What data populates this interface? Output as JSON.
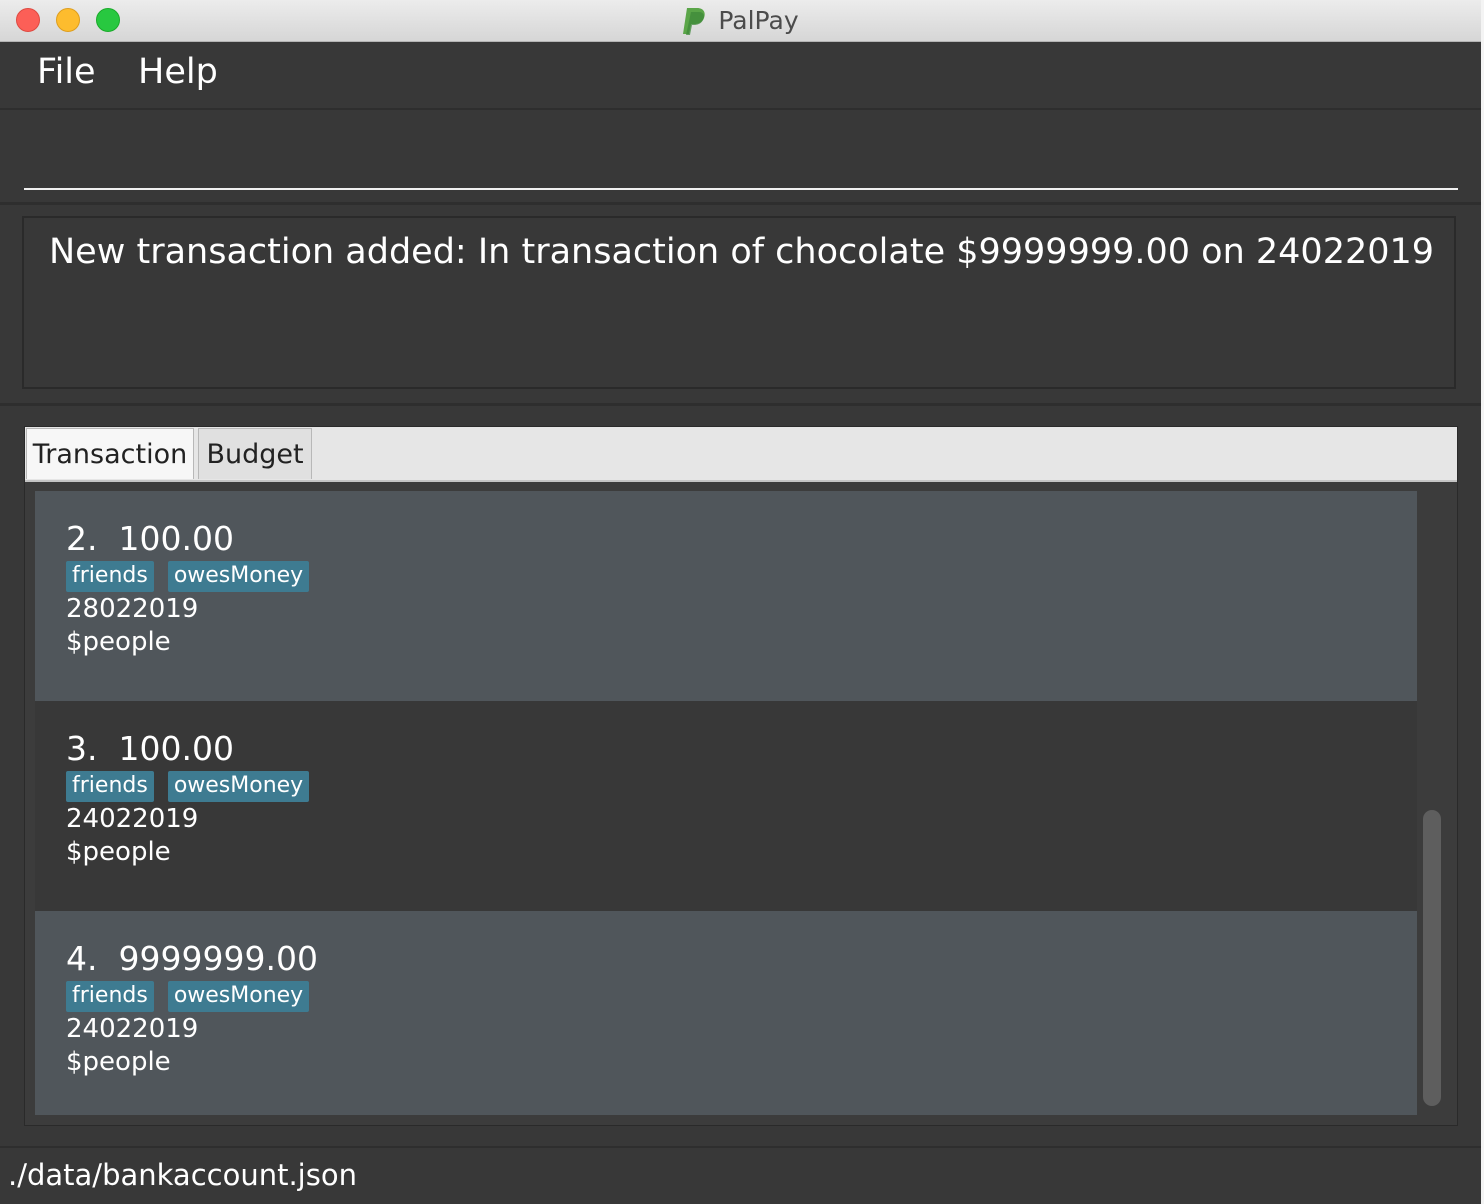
{
  "window": {
    "title": "PalPay",
    "logo_icon": "paypal-p-icon"
  },
  "menu": {
    "items": [
      {
        "label": "File"
      },
      {
        "label": "Help"
      }
    ]
  },
  "command": {
    "value": ""
  },
  "result": {
    "message": "New transaction added: In transaction of chocolate $9999999.00 on 24022019"
  },
  "tabs": [
    {
      "label": "Transaction",
      "active": true
    },
    {
      "label": "Budget",
      "active": false
    }
  ],
  "transactions": [
    {
      "index": "2.",
      "amount": "100.00",
      "tags": [
        "friends",
        "owesMoney"
      ],
      "date": "28022019",
      "description": "$people"
    },
    {
      "index": "3.",
      "amount": "100.00",
      "tags": [
        "friends",
        "owesMoney"
      ],
      "date": "24022019",
      "description": "$people"
    },
    {
      "index": "4.",
      "amount": "9999999.00",
      "tags": [
        "friends",
        "owesMoney"
      ],
      "date": "24022019",
      "description": "$people"
    }
  ],
  "status": {
    "file_path": "./data/bankaccount.json"
  },
  "colors": {
    "background": "#383838",
    "card_light": "#50565b",
    "tag": "#3e7b91"
  }
}
